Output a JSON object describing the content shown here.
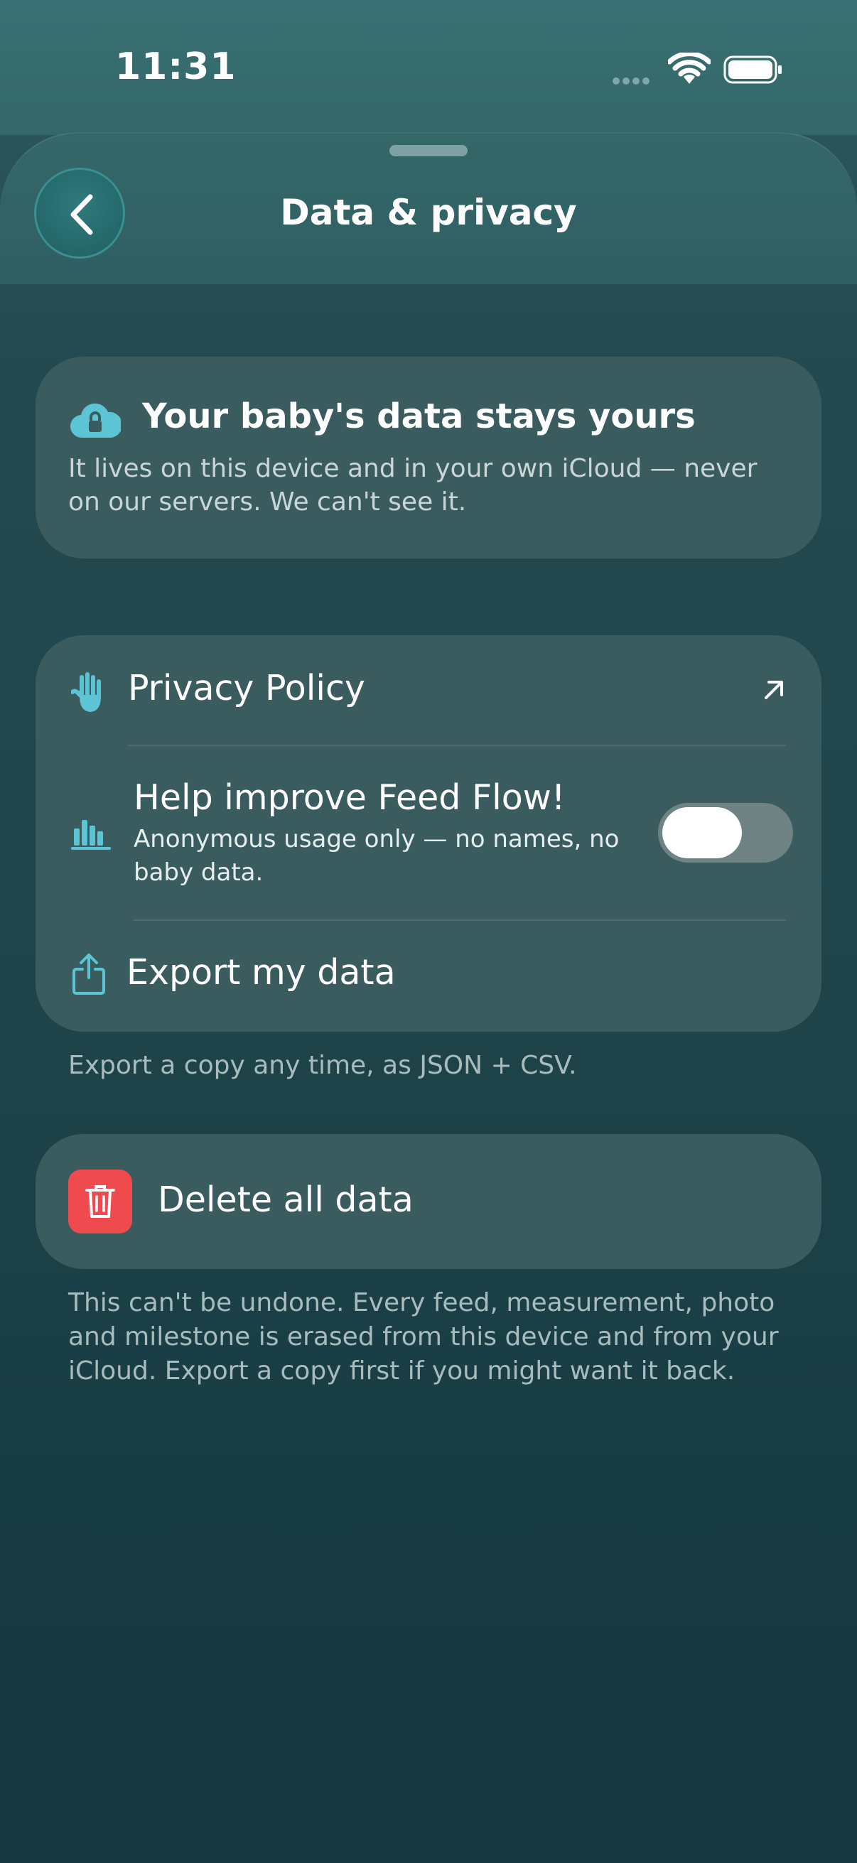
{
  "status_bar": {
    "time": "11:31"
  },
  "header": {
    "title": "Data & privacy"
  },
  "hero": {
    "title": "Your baby's data stays yours",
    "body": "It lives on this device and in your own iCloud — never on our servers. We can't see it.",
    "icon": "cloud-lock-icon"
  },
  "settings": {
    "privacy_policy": {
      "label": "Privacy Policy",
      "icon": "hand-icon",
      "trailing_icon": "external-arrow-icon"
    },
    "improve": {
      "label": "Help improve Feed Flow!",
      "sublabel": "Anonymous usage only — no names, no baby data.",
      "icon": "bar-chart-icon",
      "toggle_on": false
    },
    "export": {
      "label": "Export my data",
      "icon": "share-icon"
    }
  },
  "export_note": "Export a copy any time, as JSON + CSV.",
  "delete": {
    "label": "Delete all data",
    "icon": "trash-icon",
    "color": "#ef4a4e",
    "note": "This can't be undone. Every feed, measurement, photo and milestone is erased from this device and from your iCloud. Export a copy first if you might want it back."
  },
  "colors": {
    "accent": "#5cc4d4",
    "destructive": "#ef4a4e"
  }
}
